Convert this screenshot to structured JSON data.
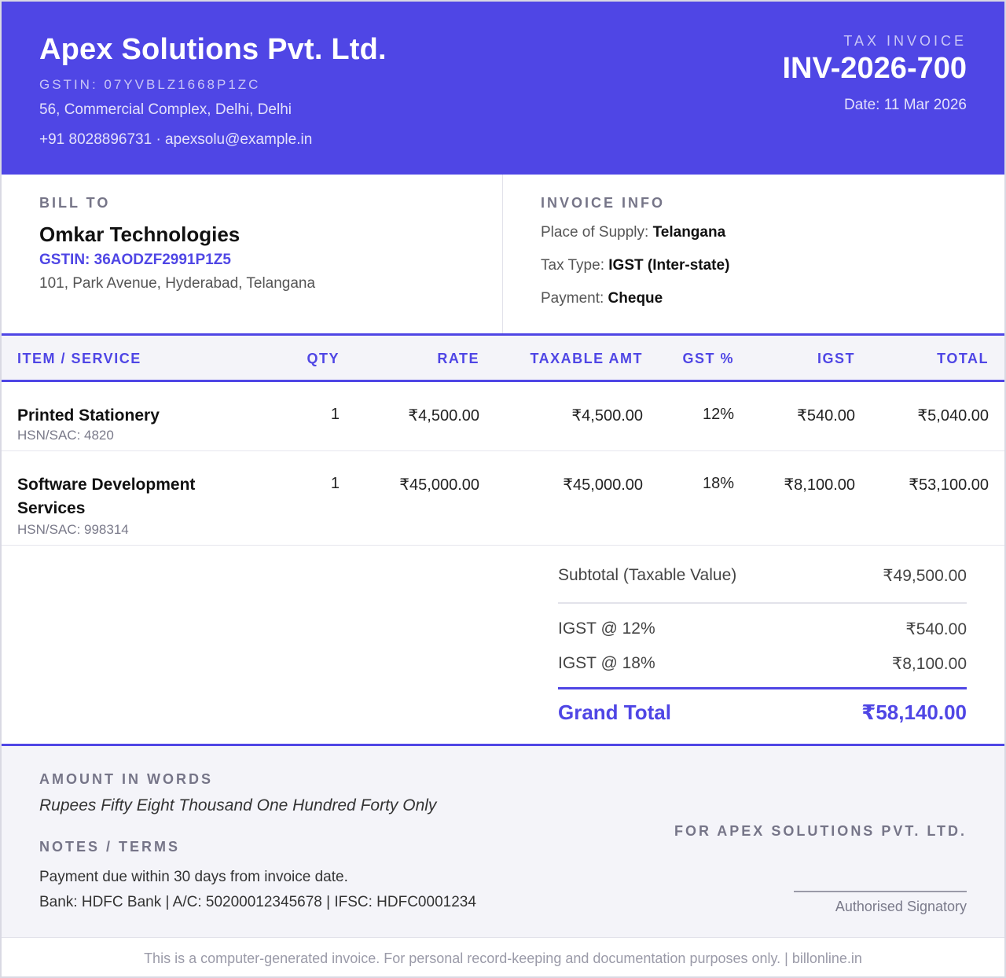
{
  "seller": {
    "name": "Apex Solutions Pvt. Ltd.",
    "gstin": "GSTIN: 07YVBLZ1668P1ZC",
    "address": "56, Commercial Complex, Delhi, Delhi",
    "contact": "+91 8028896731 · apexsolu@example.in"
  },
  "invoice": {
    "label": "TAX INVOICE",
    "number": "INV-2026-700",
    "date": "Date: 11 Mar 2026"
  },
  "bill_to": {
    "label": "BILL TO",
    "name": "Omkar Technologies",
    "gstin": "GSTIN: 36AODZF2991P1Z5",
    "address": "101, Park Avenue, Hyderabad, Telangana"
  },
  "info": {
    "label": "INVOICE INFO",
    "place_label": "Place of Supply:",
    "place_value": "Telangana",
    "tax_label": "Tax Type:",
    "tax_value": "IGST (Inter-state)",
    "payment_label": "Payment:",
    "payment_value": "Cheque"
  },
  "table": {
    "headers": [
      "ITEM / SERVICE",
      "QTY",
      "RATE",
      "TAXABLE AMT",
      "GST %",
      "IGST",
      "TOTAL"
    ],
    "rows": [
      {
        "item": "Printed Stationery",
        "hsn": "HSN/SAC: 4820",
        "qty": "1",
        "rate": "₹4,500.00",
        "taxable": "₹4,500.00",
        "gst": "12%",
        "igst": "₹540.00",
        "total": "₹5,040.00"
      },
      {
        "item": "Software Development Services",
        "hsn": "HSN/SAC: 998314",
        "qty": "1",
        "rate": "₹45,000.00",
        "taxable": "₹45,000.00",
        "gst": "18%",
        "igst": "₹8,100.00",
        "total": "₹53,100.00"
      }
    ]
  },
  "totals": {
    "subtotal_label": "Subtotal (Taxable Value)",
    "subtotal_value": "₹49,500.00",
    "igst12_label": "IGST @ 12%",
    "igst12_value": "₹540.00",
    "igst18_label": "IGST @ 18%",
    "igst18_value": "₹8,100.00",
    "grand_label": "Grand Total",
    "grand_value": "₹58,140.00"
  },
  "footer": {
    "words_label": "AMOUNT IN WORDS",
    "words": "Rupees Fifty Eight Thousand One Hundred Forty Only",
    "notes_label": "NOTES / TERMS",
    "note1": "Payment due within 30 days from invoice date.",
    "note2": "Bank: HDFC Bank | A/C: 50200012345678 | IFSC: HDFC0001234",
    "for_company": "FOR APEX SOLUTIONS PVT. LTD.",
    "signatory": "Authorised Signatory",
    "disclaimer": "This is a computer-generated invoice. For personal record-keeping and documentation purposes only. | billonline.in"
  },
  "colors": {
    "brand": "#4f46e5",
    "panel": "#f4f4f9"
  }
}
